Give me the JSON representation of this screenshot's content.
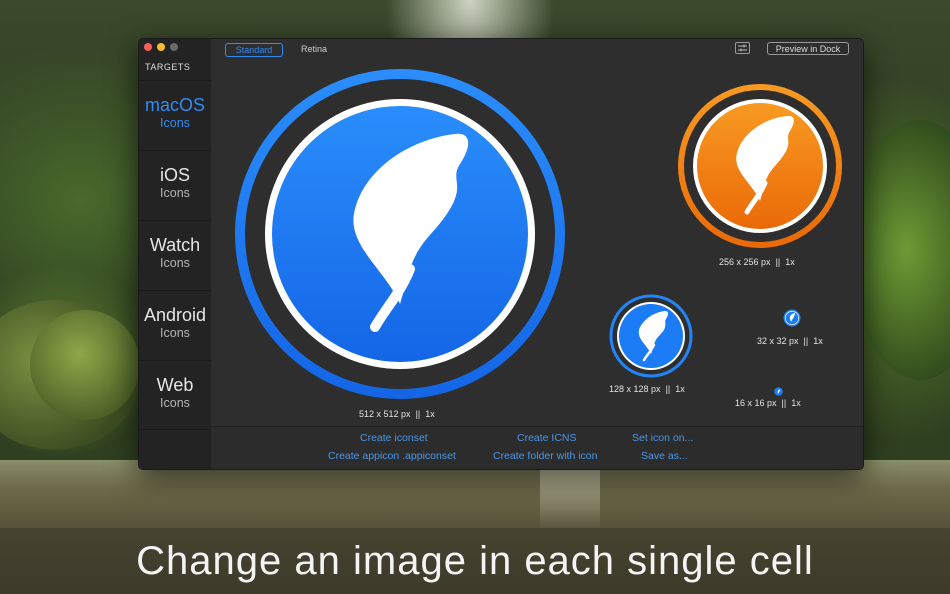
{
  "window": {
    "sidebar": {
      "header": "TARGETS",
      "items": [
        {
          "title": "macOS",
          "subtitle": "Icons"
        },
        {
          "title": "iOS",
          "subtitle": "Icons"
        },
        {
          "title": "Watch",
          "subtitle": "Icons"
        },
        {
          "title": "Android",
          "subtitle": "Icons"
        },
        {
          "title": "Web",
          "subtitle": "Icons"
        }
      ]
    },
    "toolbar": {
      "standard_label": "Standard",
      "retina_label": "Retina",
      "preview_label": "Preview in Dock"
    },
    "cells": [
      {
        "size_label": "512 x 512 px",
        "scale_label": "1x"
      },
      {
        "size_label": "256 x 256 px",
        "scale_label": "1x"
      },
      {
        "size_label": "128 x 128 px",
        "scale_label": "1x"
      },
      {
        "size_label": "32 x 32 px",
        "scale_label": "1x"
      },
      {
        "size_label": "16 x 16 px",
        "scale_label": "1x"
      }
    ],
    "separator": "||",
    "footer": {
      "create_iconset": "Create iconset",
      "create_appicon": "Create appicon .appiconset",
      "create_icns": "Create ICNS",
      "create_folder": "Create folder with icon",
      "set_icon": "Set icon on...",
      "save_as": "Save as..."
    }
  },
  "caption": "Change an image in each single cell",
  "colors": {
    "accent": "#2f8cf7",
    "blue_icon": "#1c7cf5",
    "orange_icon": "#f07a10",
    "link": "#4a97e8"
  }
}
